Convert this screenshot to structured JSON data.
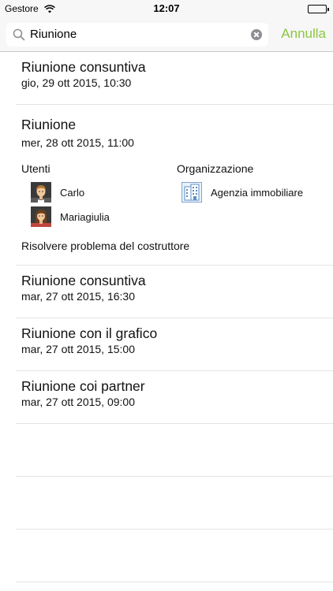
{
  "status_bar": {
    "carrier": "Gestore",
    "time": "12:07"
  },
  "search": {
    "query": "Riunione",
    "cancel_label": "Annulla"
  },
  "colors": {
    "accent": "#8cc63f",
    "separator": "#e4e4e4",
    "header_bg": "#f7f7f7"
  },
  "results": [
    {
      "title": "Riunione consuntiva",
      "date": "gio, 29 ott 2015, 10:30"
    },
    {
      "title": "Riunione",
      "date": "mer, 28 ott 2015, 11:00",
      "users_label": "Utenti",
      "organization_label": "Organizzazione",
      "users": [
        {
          "name": "Carlo",
          "icon": "male-avatar-icon"
        },
        {
          "name": "Mariagiulia",
          "icon": "female-avatar-icon"
        }
      ],
      "organization": {
        "name": "Agenzia immobiliare",
        "icon": "building-icon"
      },
      "note": "Risolvere problema del costruttore"
    },
    {
      "title": "Riunione consuntiva",
      "date": "mar, 27 ott 2015, 16:30"
    },
    {
      "title": "Riunione con il grafico",
      "date": "mar, 27 ott 2015, 15:00"
    },
    {
      "title": "Riunione coi partner",
      "date": "mar, 27 ott 2015, 09:00"
    }
  ]
}
